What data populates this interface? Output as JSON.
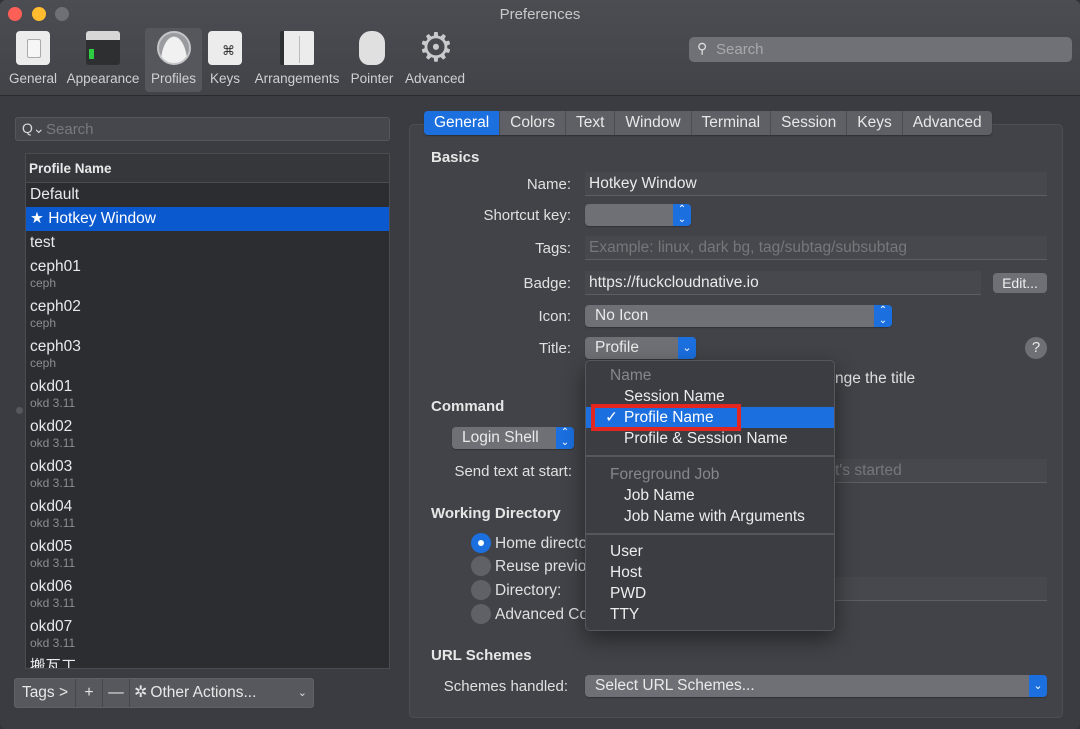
{
  "window": {
    "title": "Preferences"
  },
  "toolbar": {
    "items": [
      {
        "label": "General",
        "icon": "general-icon"
      },
      {
        "label": "Appearance",
        "icon": "appearance-icon"
      },
      {
        "label": "Profiles",
        "icon": "profiles-icon",
        "active": true
      },
      {
        "label": "Keys",
        "icon": "keys-icon"
      },
      {
        "label": "Arrangements",
        "icon": "arrangements-icon"
      },
      {
        "label": "Pointer",
        "icon": "pointer-icon"
      },
      {
        "label": "Advanced",
        "icon": "gear-icon"
      }
    ],
    "keys_glyph": "⌘",
    "gear_glyph": "⚙",
    "search_placeholder": "Search",
    "search_glyph": "⚲"
  },
  "profiles": {
    "search_placeholder": "Search",
    "search_glyph": "Q⌄",
    "column_header": "Profile Name",
    "star_glyph": "★",
    "items": [
      {
        "name": "Default",
        "tag": ""
      },
      {
        "name": "Hotkey Window",
        "tag": "",
        "starred": true,
        "selected": true
      },
      {
        "name": "test",
        "tag": ""
      },
      {
        "name": "ceph01",
        "tag": "ceph"
      },
      {
        "name": "ceph02",
        "tag": "ceph"
      },
      {
        "name": "ceph03",
        "tag": "ceph"
      },
      {
        "name": "okd01",
        "tag": "okd 3.11"
      },
      {
        "name": "okd02",
        "tag": "okd 3.11"
      },
      {
        "name": "okd03",
        "tag": "okd 3.11"
      },
      {
        "name": "okd04",
        "tag": "okd 3.11"
      },
      {
        "name": "okd05",
        "tag": "okd 3.11"
      },
      {
        "name": "okd06",
        "tag": "okd 3.11"
      },
      {
        "name": "okd07",
        "tag": "okd 3.11"
      },
      {
        "name": "搬瓦工",
        "tag": ""
      }
    ],
    "bottom_bar": {
      "tags_label": "Tags >",
      "add_label": "+",
      "remove_label": "—",
      "other_actions_label": "Other Actions...",
      "gear_glyph": "✲",
      "chevron_glyph": "⌄"
    }
  },
  "tabs": [
    {
      "label": "General",
      "active": true
    },
    {
      "label": "Colors"
    },
    {
      "label": "Text"
    },
    {
      "label": "Window"
    },
    {
      "label": "Terminal"
    },
    {
      "label": "Session"
    },
    {
      "label": "Keys"
    },
    {
      "label": "Advanced"
    }
  ],
  "general": {
    "basics": {
      "heading": "Basics",
      "name_label": "Name:",
      "name_value": "Hotkey Window",
      "shortcut_label": "Shortcut key:",
      "shortcut_value": "",
      "tags_label": "Tags:",
      "tags_placeholder": "Example: linux, dark bg, tag/subtag/subsubtag",
      "badge_label": "Badge:",
      "badge_value": "https://fuckcloudnative.io",
      "edit_label": "Edit...",
      "icon_label": "Icon:",
      "icon_value": "No Icon",
      "title_label": "Title:",
      "title_value": "Profile",
      "help_glyph": "?",
      "title_hint_visible": "nge the title"
    },
    "command": {
      "heading": "Command",
      "shell_value": "Login Shell",
      "send_text_label": "Send text at start:",
      "send_text_placeholder_visible": "t's started"
    },
    "working_directory": {
      "heading": "Working Directory",
      "options": [
        {
          "label": "Home directory",
          "selected": true
        },
        {
          "label": "Reuse previous session's directory"
        },
        {
          "label": "Directory:"
        },
        {
          "label": "Advanced Configuration"
        }
      ]
    },
    "url_schemes": {
      "heading": "URL Schemes",
      "label": "Schemes handled:",
      "value": "Select URL Schemes...",
      "chevron_glyph": "⌄"
    }
  },
  "title_menu": {
    "check_glyph": "✓",
    "groups": [
      {
        "header": "Name",
        "items": [
          {
            "label": "Session Name"
          },
          {
            "label": "Profile Name",
            "checked": true,
            "highlighted": true
          },
          {
            "label": "Profile & Session Name"
          }
        ]
      },
      {
        "header": "Foreground Job",
        "items": [
          {
            "label": "Job Name"
          },
          {
            "label": "Job Name with Arguments"
          }
        ]
      },
      {
        "header": "",
        "items": [
          {
            "label": "User"
          },
          {
            "label": "Host"
          },
          {
            "label": "PWD"
          },
          {
            "label": "TTY"
          }
        ]
      }
    ],
    "highlight_color": "#e3261f"
  },
  "colors": {
    "accent": "#1b6fdf",
    "selection": "#0a59cf",
    "annotation": "#e3261f"
  }
}
